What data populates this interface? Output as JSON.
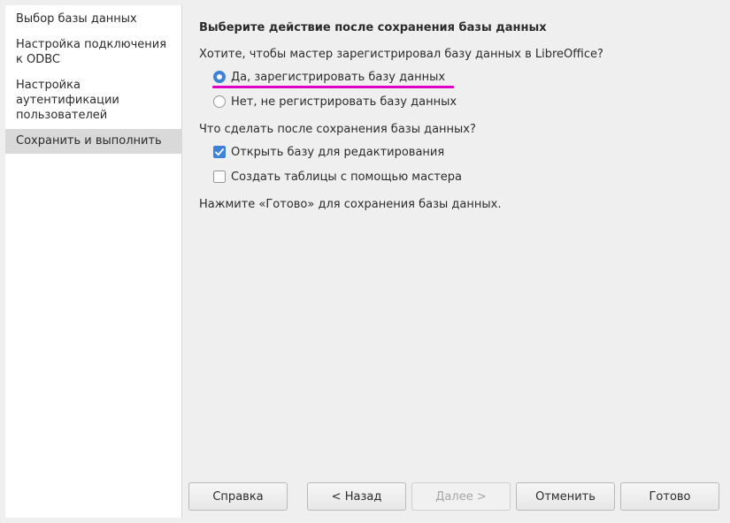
{
  "steps": [
    {
      "label": "Выбор базы данных"
    },
    {
      "label": "Настройка подключения к ODBC"
    },
    {
      "label": "Настройка аутентификации пользователей"
    },
    {
      "label": "Сохранить и выполнить"
    }
  ],
  "main": {
    "heading": "Выберите действие после сохранения базы данных",
    "register_question": "Хотите, чтобы мастер зарегистрировал базу данных в LibreOffice?",
    "register_yes": "Да, зарегистрировать базу данных",
    "register_no": "Нет, не регистрировать базу данных",
    "after_question": "Что сделать после сохранения базы данных?",
    "open_for_edit": "Открыть базу для редактирования",
    "create_tables": "Создать таблицы с помощью мастера",
    "finish_hint": "Нажмите «Готово» для сохранения базы данных."
  },
  "buttons": {
    "help": "Справка",
    "back": "< Назад",
    "next": "Далее >",
    "cancel": "Отменить",
    "finish": "Готово"
  },
  "colors": {
    "accent": "#3c82d6",
    "highlight_underline": "#e000c8"
  }
}
